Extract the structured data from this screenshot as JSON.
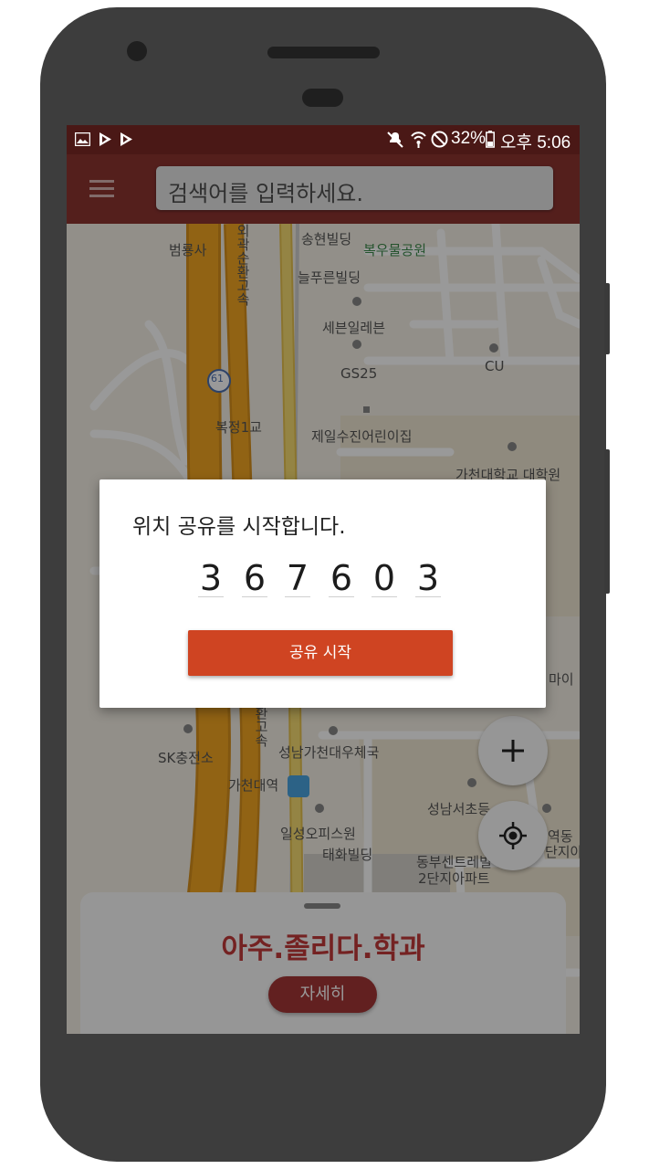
{
  "status_bar": {
    "battery": "32%",
    "time": "오후 5:06",
    "left_icons": [
      "image-icon",
      "play-store-icon",
      "play-store-icon"
    ],
    "right_icons": [
      "mute-icon",
      "wifi-icon",
      "blocked-icon",
      "battery-icon"
    ]
  },
  "app_bar": {
    "menu_icon": "hamburger-menu-icon",
    "search_placeholder": "검색어를 입력하세요."
  },
  "map": {
    "labels": [
      "범룡사",
      "송현빌딩",
      "복우물공원",
      "늘푸른빌딩",
      "세븐일레븐",
      "GS25",
      "CU",
      "61",
      "복정1교",
      "제일수진어린이집",
      "가천대학교 대학원",
      "마이",
      "SK충전소",
      "성남가천대우체국",
      "가천대역",
      "성남서초등",
      "역동",
      "단지아",
      "일성오피스원",
      "태화빌딩",
      "동부센트레빌",
      "2단지아파트",
      "외곽순환고속",
      "환고속"
    ]
  },
  "fab": {
    "zoom_in_icon": "plus-icon",
    "locate_icon": "my-location-icon"
  },
  "bottom_sheet": {
    "title": "아주.졸리다.학과",
    "detail_button": "자세히"
  },
  "dialog": {
    "message": "위치 공유를 시작합니다.",
    "code_digits": [
      "3",
      "6",
      "7",
      "6",
      "0",
      "3"
    ],
    "share_button": "공유 시작"
  },
  "colors": {
    "app_bar": "#8c3430",
    "status_bar": "#4a1816",
    "share_button": "#cf4422",
    "sheet_title": "#c23a3a",
    "highway": "#f2a622"
  }
}
